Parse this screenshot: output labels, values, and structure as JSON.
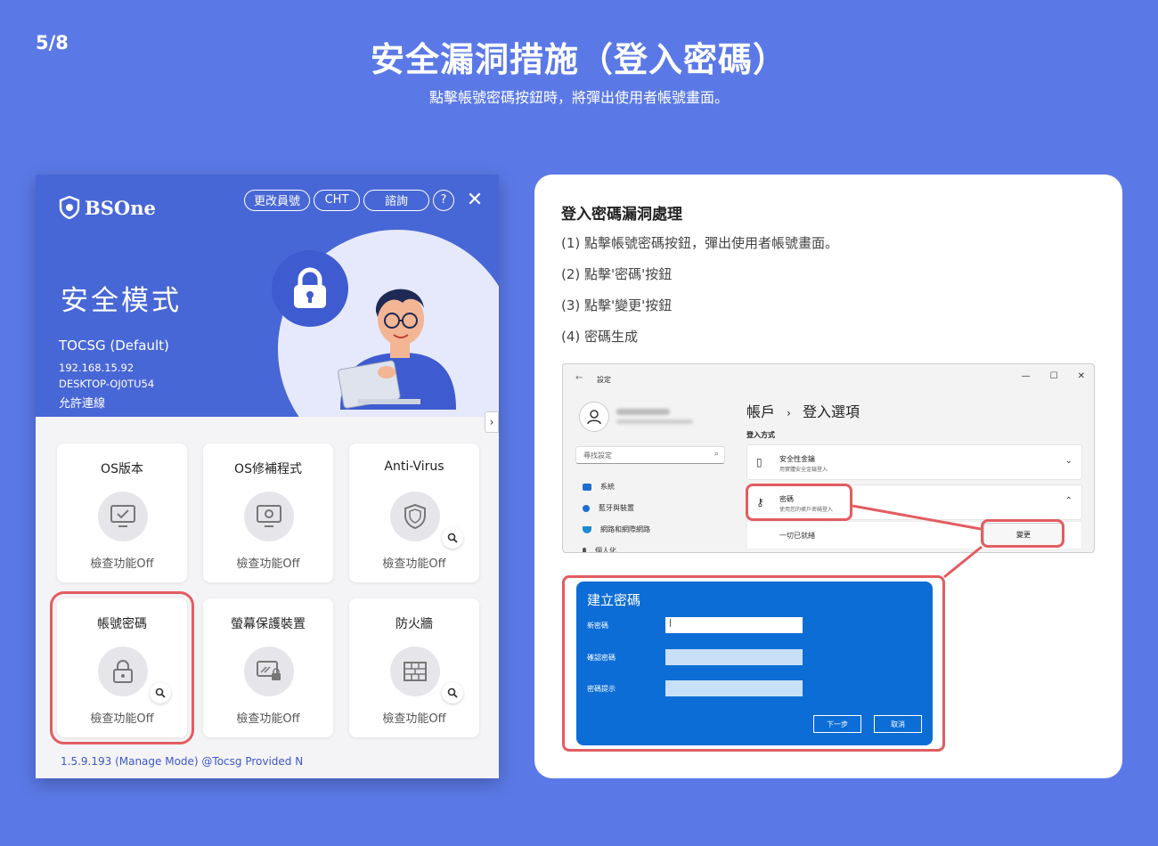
{
  "slide": {
    "page": "5/8",
    "title": "安全漏洞措施（登入密碼）",
    "subtitle": "點擊帳號密碼按鈕時，將彈出使用者帳號畫面。"
  },
  "app": {
    "brand": "BSOne",
    "buttons": {
      "change_staff": "更改員號",
      "language": "CHT",
      "inquiry": "諮詢",
      "help": "?",
      "close": "✕"
    },
    "mode_title": "安全模式",
    "org": "TOCSG (Default)",
    "ip": "192.168.15.92",
    "hostname": "DESKTOP-OJ0TU54",
    "connection": "允許連線",
    "expand": "›",
    "cards": [
      {
        "title": "OS版本",
        "status": "檢查功能Off"
      },
      {
        "title": "OS修補程式",
        "status": "檢查功能Off"
      },
      {
        "title": "Anti-Virus",
        "status": "檢查功能Off"
      },
      {
        "title": "帳號密碼",
        "status": "檢查功能Off"
      },
      {
        "title": "螢幕保護裝置",
        "status": "檢查功能Off"
      },
      {
        "title": "防火牆",
        "status": "檢查功能Off"
      }
    ],
    "version": "1.5.9.193 (Manage Mode) @Tocsg Provided N"
  },
  "guide": {
    "title": "登入密碼漏洞處理",
    "steps": [
      "(1) 點擊帳號密碼按鈕，彈出使用者帳號畫面。",
      "(2) 點擊'密碼'按鈕",
      "(3) 點擊'變更'按鈕",
      "(4) 密碼生成"
    ]
  },
  "settings": {
    "app_title": "設定",
    "back": "←",
    "win_ctrls": [
      "—",
      "☐",
      "✕"
    ],
    "search_placeholder": "尋找設定",
    "nav": [
      {
        "label": "系統",
        "color": "#1f6fd0"
      },
      {
        "label": "藍牙與裝置",
        "color": "#1f6fd0"
      },
      {
        "label": "網路和網際網路",
        "color": "#1f8ad0"
      },
      {
        "label": "個人化",
        "color": "#555555"
      }
    ],
    "breadcrumb_parent": "帳戶",
    "breadcrumb_sep": "›",
    "breadcrumb_current": "登入選項",
    "section": "登入方式",
    "security_key": {
      "title": "安全性金鑰",
      "desc": "用實體安全金鑰登入"
    },
    "password": {
      "title": "密碼",
      "desc": "使用您的帳戶密碼登入"
    },
    "status": "一切已就緒",
    "change": "變更"
  },
  "dialog": {
    "title": "建立密碼",
    "new_password": "新密碼",
    "confirm_password": "確認密碼",
    "hint": "密碼提示",
    "next": "下一步",
    "cancel": "取消"
  },
  "colors": {
    "background": "#5b79e6",
    "accent": "#4867d6",
    "highlight": "#e25d61",
    "dialog": "#0d6dd6"
  }
}
